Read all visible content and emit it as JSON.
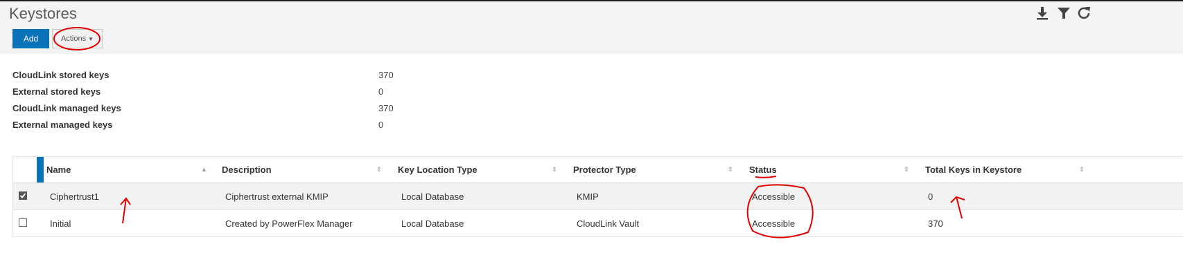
{
  "page": {
    "title": "Keystores"
  },
  "toolbar": {
    "add_label": "Add",
    "actions_label": "Actions",
    "icons": [
      "download-icon",
      "filter-icon",
      "refresh-icon"
    ]
  },
  "summary": [
    {
      "label": "CloudLink stored keys",
      "value": "370"
    },
    {
      "label": "External stored keys",
      "value": "0"
    },
    {
      "label": "CloudLink managed keys",
      "value": "370"
    },
    {
      "label": "External managed keys",
      "value": "0"
    }
  ],
  "table": {
    "columns": [
      {
        "label": "Name",
        "sort": "ascending"
      },
      {
        "label": "Description",
        "sort": "none"
      },
      {
        "label": "Key Location Type",
        "sort": "none"
      },
      {
        "label": "Protector Type",
        "sort": "none"
      },
      {
        "label": "Status",
        "sort": "none"
      },
      {
        "label": "Total Keys in Keystore",
        "sort": "none"
      }
    ],
    "rows": [
      {
        "selected": true,
        "name": "Ciphertrust1",
        "description": "Ciphertrust external KMIP",
        "key_location_type": "Local Database",
        "protector_type": "KMIP",
        "status": "Accessible",
        "total_keys": "0"
      },
      {
        "selected": false,
        "name": "Initial",
        "description": "Created by PowerFlex Manager",
        "key_location_type": "Local Database",
        "protector_type": "CloudLink Vault",
        "status": "Accessible",
        "total_keys": "370"
      }
    ]
  },
  "colors": {
    "accent": "#0a72b8",
    "annotation": "#e00000",
    "selected_row": "#f2f2f2"
  }
}
